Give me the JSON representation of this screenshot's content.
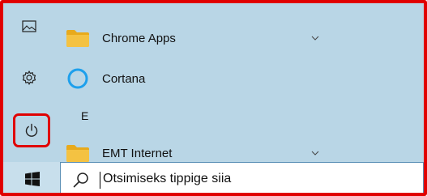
{
  "rail": {
    "items": [
      {
        "icon": "pictures-icon"
      },
      {
        "icon": "gear-icon"
      },
      {
        "icon": "power-icon"
      }
    ]
  },
  "apps": [
    {
      "label": "Chrome Apps",
      "icon": "folder-icon",
      "expandable": true
    },
    {
      "label": "Cortana",
      "icon": "cortana-icon",
      "expandable": false
    }
  ],
  "group_letter": "E",
  "apps_after_letter": [
    {
      "label": "EMT Internet",
      "icon": "folder-icon",
      "expandable": true
    }
  ],
  "taskbar": {
    "start_icon": "windows-logo-icon",
    "search_placeholder": "Otsimiseks tippige siia"
  },
  "colors": {
    "menu_background": "#b9d6e6",
    "folder": "#f4c242",
    "cortana_ring": "#1ea0ec",
    "highlight": "#e00000"
  }
}
